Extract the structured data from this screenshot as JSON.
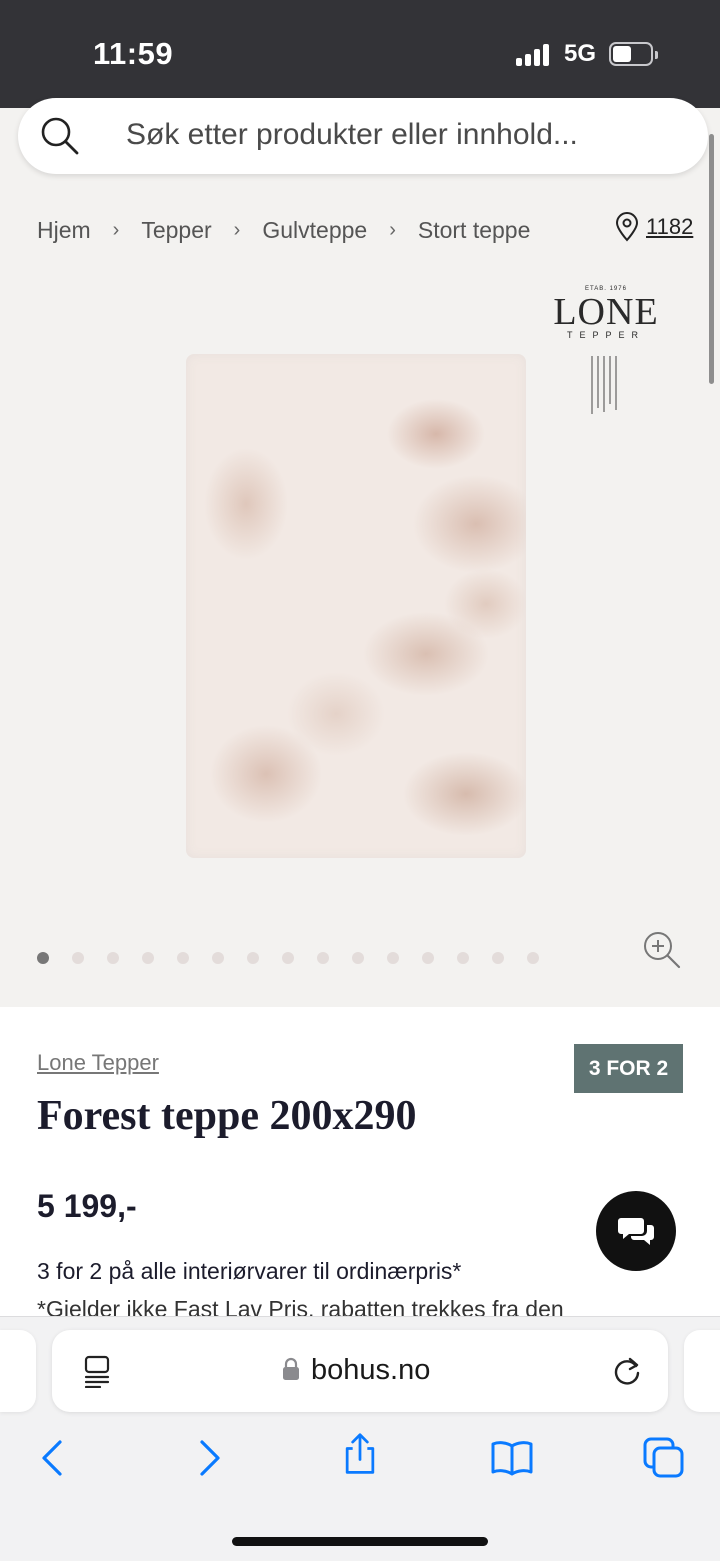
{
  "status_bar": {
    "time": "11:59",
    "network": "5G"
  },
  "search": {
    "placeholder": "Søk etter produkter eller innhold..."
  },
  "breadcrumb": {
    "items": [
      "Hjem",
      "Tepper",
      "Gulvteppe",
      "Stort teppe"
    ]
  },
  "location": {
    "label": "1182"
  },
  "brand_logo": {
    "etab": "ETAB. 1976",
    "name": "LONE",
    "sub": "TEPPER"
  },
  "gallery": {
    "total_images": 15,
    "active_index": 0
  },
  "product": {
    "brand": "Lone Tepper",
    "badge": "3 FOR 2",
    "title": "Forest teppe 200x290",
    "price": "5 199,-",
    "promo_text": "3 for 2 på alle interiørvarer til ordinærpris*",
    "promo_note": "*Gjelder ikke Fast Lav Pris, rabatten trekkes fra den"
  },
  "browser": {
    "url": "bohus.no"
  },
  "colors": {
    "badge": "#5f7372",
    "text_dark": "#1c1c2c",
    "ios_blue": "#0a7aff",
    "status_bg": "#333337"
  },
  "icons": [
    "search-icon",
    "location-pin-icon",
    "zoom-icon",
    "chat-icon",
    "reader-icon",
    "lock-icon",
    "reload-icon",
    "back-icon",
    "forward-icon",
    "share-icon",
    "bookmarks-icon",
    "tabs-icon"
  ]
}
